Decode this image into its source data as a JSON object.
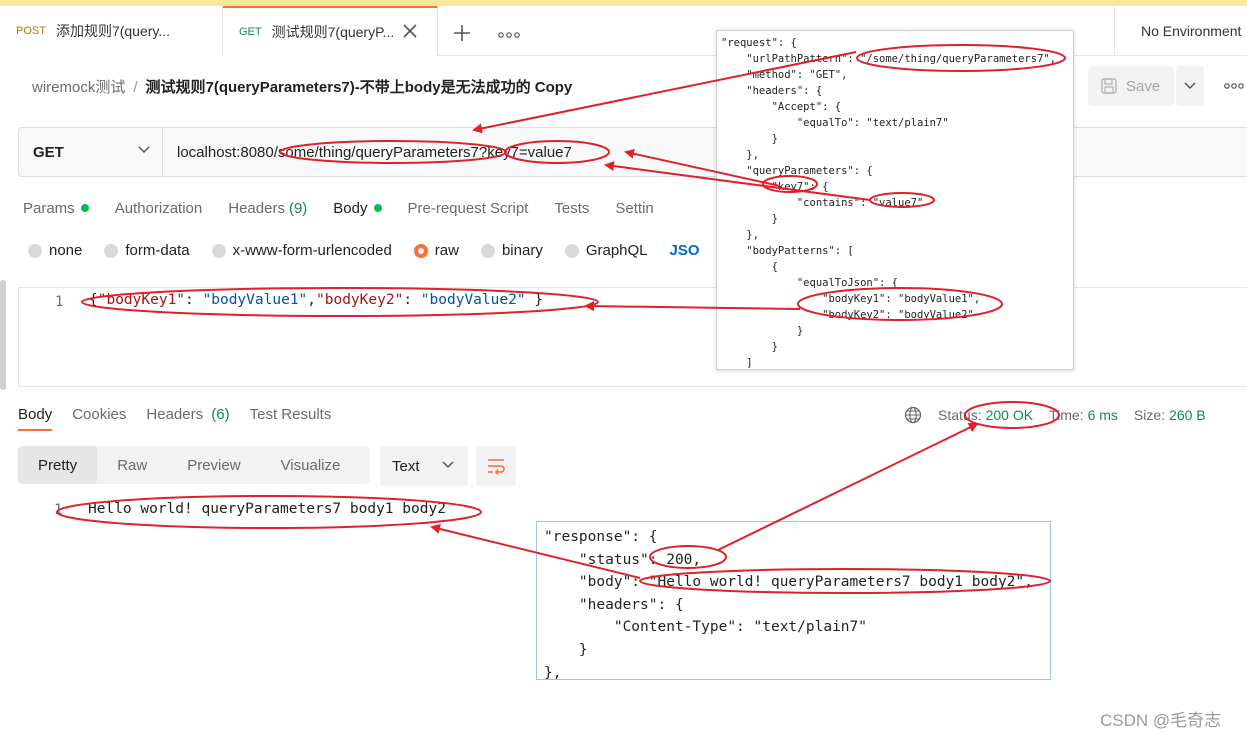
{
  "tabs": [
    {
      "method": "POST",
      "title": "添加规则7(query..."
    },
    {
      "method": "GET",
      "title": "测试规则7(queryP..."
    }
  ],
  "environment": "No Environment",
  "breadcrumb": {
    "parent": "wiremock测试",
    "separator": "/",
    "current": "测试规则7(queryParameters7)-不带上body是无法成功的 Copy"
  },
  "toolbar": {
    "save_label": "Save"
  },
  "request": {
    "method": "GET",
    "url_prefix": "localhost:8080",
    "url_path": "/some/thing/queryParameters7",
    "url_query": "?key7=value7",
    "tabs": [
      {
        "label": "Params",
        "dot": true
      },
      {
        "label": "Authorization"
      },
      {
        "label": "Headers",
        "count": "(9)"
      },
      {
        "label": "Body",
        "dot": true
      },
      {
        "label": "Pre-request Script"
      },
      {
        "label": "Tests"
      },
      {
        "label": "Settin"
      }
    ],
    "body_types": [
      "none",
      "form-data",
      "x-www-form-urlencoded",
      "raw",
      "binary",
      "GraphQL"
    ],
    "body_format": "JSO",
    "body_line_number": "1",
    "body_code": {
      "open": "{",
      "k1": "\"bodyKey1\"",
      "v1": "\"bodyValue1\"",
      "k2": "\"bodyKey2\"",
      "v2": "\"bodyValue2\"",
      "close": "}"
    }
  },
  "response": {
    "tabs": [
      {
        "label": "Body"
      },
      {
        "label": "Cookies"
      },
      {
        "label": "Headers",
        "count": "(6)"
      },
      {
        "label": "Test Results"
      }
    ],
    "status_label": "Status:",
    "status_value": "200 OK",
    "time_label": "Time:",
    "time_value": "6 ms",
    "size_label": "Size:",
    "size_value": "260 B",
    "view_modes": [
      "Pretty",
      "Raw",
      "Preview",
      "Visualize"
    ],
    "format": "Text",
    "line_number": "1",
    "body_text": "Hello world! queryParameters7 body1 body2"
  },
  "overlay_request": {
    "lines": [
      "\"request\": {",
      "    \"urlPathPattern\": \"/some/thing/queryParameters7\",",
      "    \"method\": \"GET\",",
      "    \"headers\": {",
      "        \"Accept\": {",
      "            \"equalTo\": \"text/plain7\"",
      "        }",
      "    },",
      "    \"queryParameters\": {",
      "        \"key7\": {",
      "            \"contains\": \"value7\"",
      "        }",
      "    },",
      "    \"bodyPatterns\": [",
      "        {",
      "            \"equalToJson\": {",
      "                \"bodyKey1\": \"bodyValue1\",",
      "                \"bodyKey2\": \"bodyValue2\"",
      "            }",
      "        }",
      "    ]"
    ]
  },
  "overlay_response": {
    "lines": [
      "\"response\": {",
      "    \"status\": 200,",
      "    \"body\": \"Hello world! queryParameters7 body1 body2\",",
      "    \"headers\": {",
      "        \"Content-Type\": \"text/plain7\"",
      "    }",
      "},"
    ]
  },
  "watermark": "CSDN @毛奇志",
  "colors": {
    "accent": "#ff6c37",
    "success": "#0f8a4a",
    "annotation": "#e0202a",
    "link": "#0265d2"
  }
}
